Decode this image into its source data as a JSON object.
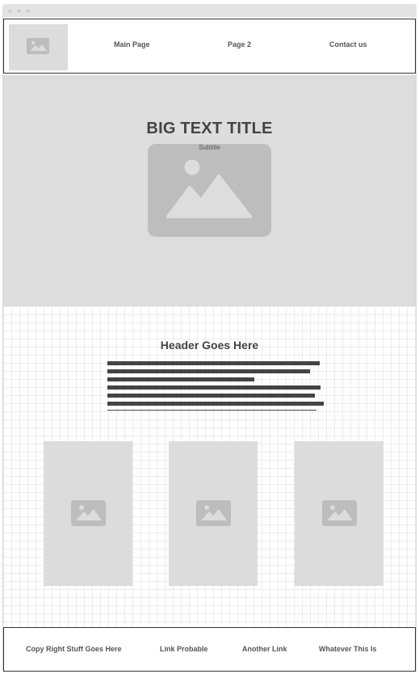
{
  "nav": {
    "logo_icon": "image-placeholder-icon",
    "links": [
      "Main Page",
      "Page 2",
      "Contact us"
    ]
  },
  "hero": {
    "title": "BIG TEXT TITLE",
    "subtitle": "Subtitle",
    "image_icon": "image-placeholder-icon"
  },
  "content": {
    "header": "Header Goes Here",
    "cards": [
      {
        "image_icon": "image-placeholder-icon"
      },
      {
        "image_icon": "image-placeholder-icon"
      },
      {
        "image_icon": "image-placeholder-icon"
      }
    ]
  },
  "footer": {
    "links": [
      "Copy Right Stuff Goes Here",
      "Link Probable",
      "Another Link",
      "Whatever This Is"
    ]
  },
  "colors": {
    "placeholder_gray": "#dcdcdc",
    "icon_gray": "#bdbdbd",
    "text_dark": "#444444"
  }
}
